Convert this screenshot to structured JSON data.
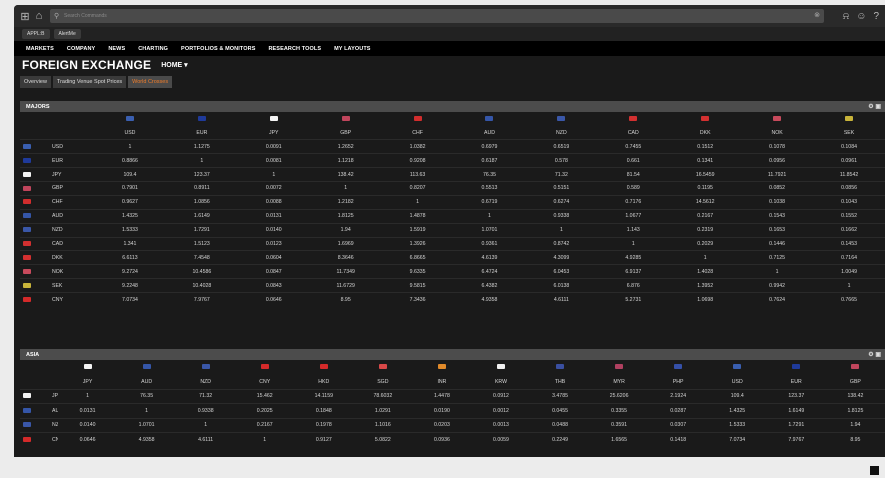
{
  "topbar": {
    "search_placeholder": "Search Commands",
    "icons": [
      "grid-icon",
      "home-icon",
      "search-icon",
      "close-icon",
      "bell-icon",
      "user-icon",
      "help-icon"
    ]
  },
  "doc_tabs": [
    "APPL:B",
    "AlertMe"
  ],
  "nav": [
    "MARKETS",
    "COMPANY",
    "NEWS",
    "CHARTING",
    "PORTFOLIOS & MONITORS",
    "RESEARCH TOOLS",
    "MY LAYOUTS"
  ],
  "page": {
    "title": "FOREIGN EXCHANGE",
    "home_label": "HOME ▾"
  },
  "sub_tabs": [
    {
      "label": "Overview",
      "active": false
    },
    {
      "label": "Trading Venue Spot Prices",
      "active": false
    },
    {
      "label": "World Crosses",
      "active": true
    }
  ],
  "majors": {
    "title": "MAJORS",
    "columns": [
      {
        "code": "USD",
        "flag": "#3a5fb0"
      },
      {
        "code": "EUR",
        "flag": "#1f3a9a"
      },
      {
        "code": "JPY",
        "flag": "#f4f4f4"
      },
      {
        "code": "GBP",
        "flag": "#c0455c"
      },
      {
        "code": "CHF",
        "flag": "#d22d2d"
      },
      {
        "code": "AUD",
        "flag": "#3556a8"
      },
      {
        "code": "NZD",
        "flag": "#3a57a8"
      },
      {
        "code": "CAD",
        "flag": "#d23030"
      },
      {
        "code": "DKK",
        "flag": "#d43030"
      },
      {
        "code": "NOK",
        "flag": "#c84a5c"
      },
      {
        "code": "SEK",
        "flag": "#c8b43a"
      }
    ],
    "rows": [
      {
        "code": "USD",
        "flag": "#3a5fb0",
        "values": [
          "1",
          "1.1275",
          "0.0091",
          "1.2652",
          "1.0382",
          "0.6979",
          "0.6519",
          "0.7455",
          "0.1512",
          "0.1078",
          "0.1084"
        ]
      },
      {
        "code": "EUR",
        "flag": "#1f3a9a",
        "values": [
          "0.8866",
          "1",
          "0.0081",
          "1.1218",
          "0.9208",
          "0.6187",
          "0.578",
          "0.661",
          "0.1341",
          "0.0956",
          "0.0961"
        ]
      },
      {
        "code": "JPY",
        "flag": "#f4f4f4",
        "values": [
          "109.4",
          "123.37",
          "1",
          "138.42",
          "113.63",
          "76.35",
          "71.32",
          "81.54",
          "16.5459",
          "11.7921",
          "11.8542"
        ]
      },
      {
        "code": "GBP",
        "flag": "#c0455c",
        "values": [
          "0.7901",
          "0.8911",
          "0.0072",
          "1",
          "0.8207",
          "0.5513",
          "0.5151",
          "0.589",
          "0.1195",
          "0.0852",
          "0.0856"
        ]
      },
      {
        "code": "CHF",
        "flag": "#d22d2d",
        "values": [
          "0.9627",
          "1.0856",
          "0.0088",
          "1.2182",
          "1",
          "0.6719",
          "0.6274",
          "0.7176",
          "14.5612",
          "0.1038",
          "0.1043"
        ]
      },
      {
        "code": "AUD",
        "flag": "#3556a8",
        "values": [
          "1.4325",
          "1.6149",
          "0.0131",
          "1.8125",
          "1.4878",
          "1",
          "0.9338",
          "1.0677",
          "0.2167",
          "0.1543",
          "0.1552"
        ]
      },
      {
        "code": "NZD",
        "flag": "#3a57a8",
        "values": [
          "1.5333",
          "1.7291",
          "0.0140",
          "1.94",
          "1.5919",
          "1.0701",
          "1",
          "1.143",
          "0.2319",
          "0.1653",
          "0.1662"
        ]
      },
      {
        "code": "CAD",
        "flag": "#d23030",
        "values": [
          "1.341",
          "1.5123",
          "0.0123",
          "1.6969",
          "1.3926",
          "0.9361",
          "0.8742",
          "1",
          "0.2029",
          "0.1446",
          "0.1453"
        ]
      },
      {
        "code": "DKK",
        "flag": "#d43030",
        "values": [
          "6.6113",
          "7.4548",
          "0.0604",
          "8.3646",
          "6.8665",
          "4.6139",
          "4.3099",
          "4.9285",
          "1",
          "0.7125",
          "0.7164"
        ]
      },
      {
        "code": "NOK",
        "flag": "#c84a5c",
        "values": [
          "9.2724",
          "10.4586",
          "0.0847",
          "11.7349",
          "9.6335",
          "6.4724",
          "6.0453",
          "6.9137",
          "1.4028",
          "1",
          "1.0049"
        ]
      },
      {
        "code": "SEK",
        "flag": "#c8b43a",
        "values": [
          "9.2248",
          "10.4028",
          "0.0843",
          "11.6729",
          "9.5815",
          "6.4382",
          "6.0138",
          "6.876",
          "1.3952",
          "0.9942",
          "1"
        ]
      },
      {
        "code": "CNY",
        "flag": "#d42a2a",
        "values": [
          "7.0734",
          "7.9767",
          "0.0646",
          "8.95",
          "7.3436",
          "4.9358",
          "4.6111",
          "5.2731",
          "1.0698",
          "0.7624",
          "0.7665"
        ]
      }
    ]
  },
  "asia": {
    "title": "ASIA",
    "columns": [
      {
        "code": "JPY",
        "flag": "#f4f4f4"
      },
      {
        "code": "AUD",
        "flag": "#3556a8"
      },
      {
        "code": "NZD",
        "flag": "#3a57a8"
      },
      {
        "code": "CNY",
        "flag": "#d42a2a"
      },
      {
        "code": "HKD",
        "flag": "#d42a2a"
      },
      {
        "code": "SGD",
        "flag": "#d84848"
      },
      {
        "code": "INR",
        "flag": "#e08a2a"
      },
      {
        "code": "KRW",
        "flag": "#f0f0f0"
      },
      {
        "code": "THB",
        "flag": "#3a4fa0"
      },
      {
        "code": "MYR",
        "flag": "#b04060"
      },
      {
        "code": "PHP",
        "flag": "#3550a8"
      },
      {
        "code": "USD",
        "flag": "#3a5fb0"
      },
      {
        "code": "EUR",
        "flag": "#1f3a9a"
      },
      {
        "code": "GBP",
        "flag": "#c0455c"
      }
    ],
    "rows": [
      {
        "code": "JPY",
        "flag": "#f4f4f4",
        "values": [
          "1",
          "76.35",
          "71.32",
          "15.462",
          "14.1159",
          "78.6032",
          "1.4478",
          "0.0912",
          "3.4785",
          "25.6206",
          "2.1924",
          "109.4",
          "123.37",
          "138.42"
        ]
      },
      {
        "code": "AUD",
        "flag": "#3556a8",
        "values": [
          "0.0131",
          "1",
          "0.9338",
          "0.2025",
          "0.1848",
          "1.0291",
          "0.0190",
          "0.0012",
          "0.0455",
          "0.3355",
          "0.0287",
          "1.4325",
          "1.6149",
          "1.8125"
        ]
      },
      {
        "code": "NZD",
        "flag": "#3a57a8",
        "values": [
          "0.0140",
          "1.0701",
          "1",
          "0.2167",
          "0.1978",
          "1.1016",
          "0.0203",
          "0.0013",
          "0.0488",
          "0.3591",
          "0.0307",
          "1.5333",
          "1.7291",
          "1.94"
        ]
      },
      {
        "code": "CNY",
        "flag": "#d42a2a",
        "values": [
          "0.0646",
          "4.9358",
          "4.6111",
          "1",
          "0.9127",
          "5.0822",
          "0.0936",
          "0.0059",
          "0.2249",
          "1.6565",
          "0.1418",
          "7.0734",
          "7.9767",
          "8.95"
        ]
      }
    ]
  }
}
